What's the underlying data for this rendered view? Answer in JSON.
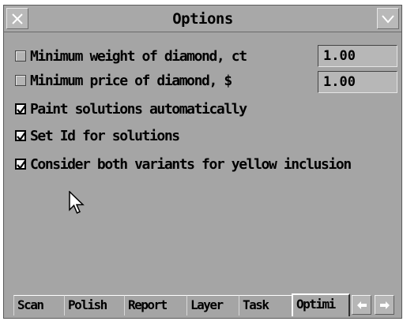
{
  "window": {
    "title": "Options"
  },
  "titlebar": {
    "close_icon": "close-icon",
    "menu_icon": "chevron-down-icon"
  },
  "options": [
    {
      "label": "Minimum weight of diamond, ct",
      "checked": false,
      "value": "1.00"
    },
    {
      "label": "Minimum price of diamond, $",
      "checked": false,
      "value": "1.00"
    },
    {
      "label": "Paint solutions automatically",
      "checked": true
    },
    {
      "label": "Set Id for solutions",
      "checked": true
    },
    {
      "label": "Consider both variants for yellow inclusion",
      "checked": true
    }
  ],
  "tabs": [
    {
      "label": "Scan",
      "active": false
    },
    {
      "label": "Polish",
      "active": false
    },
    {
      "label": "Report",
      "active": false
    },
    {
      "label": "Layer",
      "active": false
    },
    {
      "label": "Task",
      "active": false
    },
    {
      "label": "Optimi",
      "active": true
    }
  ],
  "tab_scroll": {
    "left_icon": "arrow-left-icon",
    "right_icon": "arrow-right-icon"
  },
  "colors": {
    "background": "#a5a5a5",
    "text": "#000000"
  }
}
